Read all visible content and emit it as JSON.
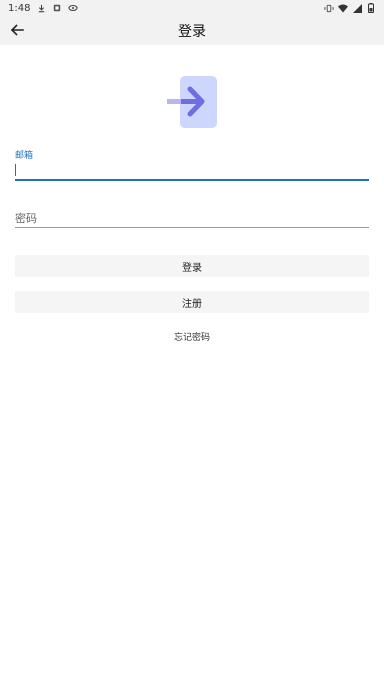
{
  "status_bar": {
    "time": "1:48",
    "left_icons": [
      "download-icon",
      "notification-icon",
      "cast-icon"
    ],
    "right_icons": [
      "vibrate-icon",
      "wifi-icon",
      "signal-icon",
      "battery-icon"
    ]
  },
  "app_bar": {
    "title": "登录",
    "back_icon": "arrow-back-icon"
  },
  "logo": {
    "icon": "login-arrow-icon",
    "colors": {
      "box": "#cdd6ff",
      "arrow": "#6f6ee0",
      "arrow_tail": "#b7b5f3"
    }
  },
  "form": {
    "email": {
      "label": "邮箱",
      "value": ""
    },
    "password": {
      "placeholder": "密码",
      "value": ""
    }
  },
  "buttons": {
    "login_label": "登录",
    "register_label": "注册"
  },
  "forgot_password_label": "忘记密码",
  "colors": {
    "accent": "#1a73c2",
    "bar_bg": "#f2f2f2",
    "button_bg": "#f5f5f5"
  }
}
